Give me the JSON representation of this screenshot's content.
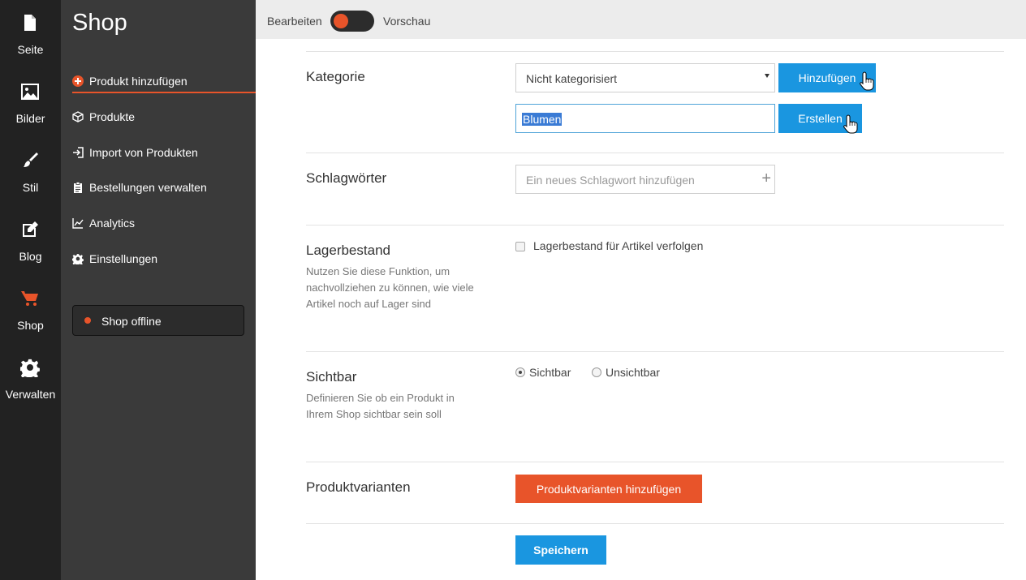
{
  "rail": {
    "items": [
      {
        "label": "Seite",
        "icon": "page-icon"
      },
      {
        "label": "Bilder",
        "icon": "image-icon"
      },
      {
        "label": "Stil",
        "icon": "brush-icon"
      },
      {
        "label": "Blog",
        "icon": "edit-icon"
      },
      {
        "label": "Shop",
        "icon": "cart-icon"
      },
      {
        "label": "Verwalten",
        "icon": "gear-icon"
      }
    ],
    "active": "Shop"
  },
  "sidebar": {
    "title": "Shop",
    "items": [
      {
        "label": "Produkt hinzufügen",
        "icon": "plus-circle-icon"
      },
      {
        "label": "Produkte",
        "icon": "box-icon"
      },
      {
        "label": "Import von Produkten",
        "icon": "import-icon"
      },
      {
        "label": "Bestellungen verwalten",
        "icon": "clipboard-icon"
      },
      {
        "label": "Analytics",
        "icon": "chart-icon"
      },
      {
        "label": "Einstellungen",
        "icon": "gear-icon"
      }
    ],
    "status_label": "Shop offline"
  },
  "topbar": {
    "edit_label": "Bearbeiten",
    "preview_label": "Vorschau"
  },
  "form": {
    "category": {
      "title": "Kategorie",
      "select_value": "Nicht kategorisiert",
      "add_button": "Hinzufügen",
      "new_value": "Blumen",
      "create_button": "Erstellen"
    },
    "tags": {
      "title": "Schlagwörter",
      "placeholder": "Ein neues Schlagwort hinzufügen"
    },
    "stock": {
      "title": "Lagerbestand",
      "description": "Nutzen Sie diese Funktion, um nachvollziehen zu können, wie viele Artikel noch auf Lager sind",
      "checkbox_label": "Lagerbestand für Artikel verfolgen"
    },
    "visibility": {
      "title": "Sichtbar",
      "description": "Definieren Sie ob ein Produkt in Ihrem Shop sichtbar sein soll",
      "option_visible": "Sichtbar",
      "option_hidden": "Unsichtbar",
      "selected": "Sichtbar"
    },
    "variants": {
      "title": "Produktvarianten",
      "button": "Produktvarianten hinzufügen"
    },
    "save_button": "Speichern"
  },
  "colors": {
    "accent_orange": "#e8542a",
    "accent_blue": "#1a96e0"
  }
}
